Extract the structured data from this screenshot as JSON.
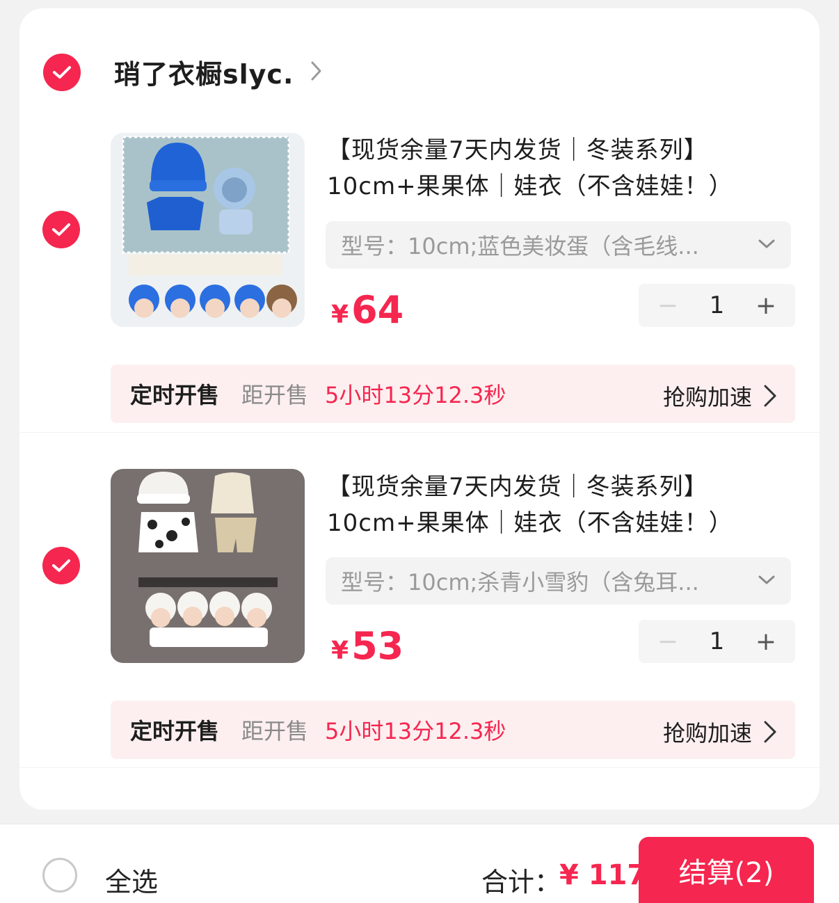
{
  "shop": {
    "name": "琑了衣橱slyc."
  },
  "items": [
    {
      "title_line1": "【现货余量7天内发货｜冬装系列】",
      "title_line2": "10cm+果果体｜娃衣（不含娃娃！）",
      "sku": "型号：10cm;蓝色美妆蛋（含毛线...",
      "currency": "¥",
      "price": "64",
      "quantity": "1",
      "presale_label": "定时开售",
      "presale_prefix": "距开售",
      "presale_countdown": "5小时13分12.3秒",
      "presale_action": "抢购加速"
    },
    {
      "title_line1": "【现货余量7天内发货｜冬装系列】",
      "title_line2": "10cm+果果体｜娃衣（不含娃娃！）",
      "sku": "型号：10cm;杀青小雪豹（含兔耳...",
      "currency": "¥",
      "price": "53",
      "quantity": "1",
      "presale_label": "定时开售",
      "presale_prefix": "距开售",
      "presale_countdown": "5小时13分12.3秒",
      "presale_action": "抢购加速"
    }
  ],
  "stepper": {
    "minus": "−",
    "plus": "+"
  },
  "footer": {
    "select_all": "全选",
    "total_label": "合计：",
    "total_value": "¥ 117",
    "checkout": "结算(2)"
  },
  "colors": {
    "accent": "#f5264f",
    "presale_bg": "#fdeff0"
  }
}
